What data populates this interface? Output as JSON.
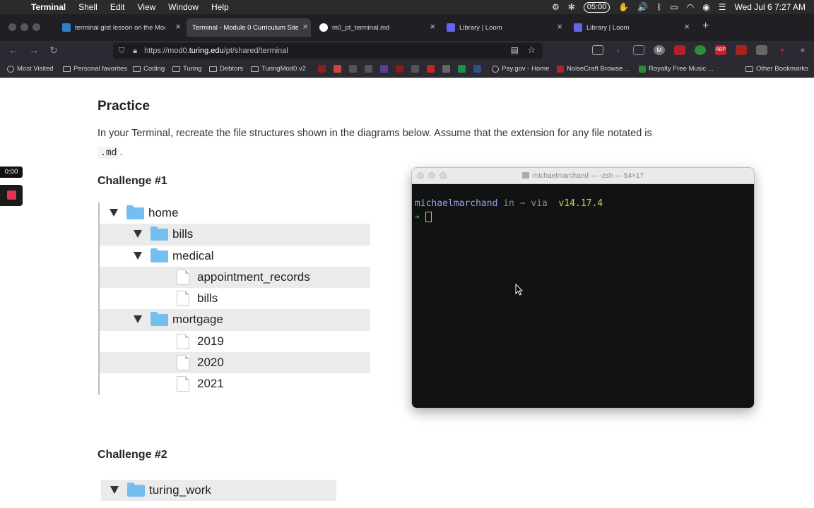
{
  "menubar": {
    "app_name": "Terminal",
    "menus": [
      "Shell",
      "Edit",
      "View",
      "Window",
      "Help"
    ],
    "timer": "05:00",
    "datetime": "Wed Jul 6  7:27 AM"
  },
  "tabs": [
    {
      "title": "terminal gist lesson on the Mod",
      "icon_color": "#2f80c9"
    },
    {
      "title": "Terminal - Module 0 Curriculum Site",
      "icon_color": "#3b3b41"
    },
    {
      "title": "m0_pt_terminal.md",
      "icon_color": "#ffffff"
    },
    {
      "title": "Library | Loom",
      "icon_color": "#6266e8"
    },
    {
      "title": "Library | Loom",
      "icon_color": "#6266e8"
    }
  ],
  "url": {
    "prefix": "https://mod0.",
    "domain": "turing.edu",
    "path": "/pt/shared/terminal"
  },
  "bookmarks": {
    "most_visited": "Most Visited",
    "personal_favorites": "Personal favorites",
    "coding": "Coding",
    "turing": "Turing",
    "debtors": "Debtors",
    "turingmod": "TuringMod0.v2",
    "paygov": "Pay.gov - Home",
    "noisecraft": "NoiseCraft Browse ...",
    "royalty": "Royalty Free Music ...",
    "other": "Other Bookmarks"
  },
  "page": {
    "heading": "Practice",
    "paragraph": "In your Terminal, recreate the file structures shown in the diagrams below. Assume that the extension for any file notated is",
    "extension": ".md",
    "period": ".",
    "challenge1": "Challenge #1",
    "challenge2": "Challenge #2"
  },
  "tree1": [
    {
      "name": "home",
      "type": "folder",
      "level": 0,
      "shaded": false
    },
    {
      "name": "bills",
      "type": "folder",
      "level": 1,
      "shaded": true
    },
    {
      "name": "medical",
      "type": "folder",
      "level": 1,
      "shaded": false
    },
    {
      "name": "appointment_records",
      "type": "file",
      "level": 2,
      "shaded": true
    },
    {
      "name": "bills",
      "type": "file",
      "level": 2,
      "shaded": false
    },
    {
      "name": "mortgage",
      "type": "folder",
      "level": 1,
      "shaded": true
    },
    {
      "name": "2019",
      "type": "file",
      "level": 2,
      "shaded": false
    },
    {
      "name": "2020",
      "type": "file",
      "level": 2,
      "shaded": true
    },
    {
      "name": "2021",
      "type": "file",
      "level": 2,
      "shaded": false
    }
  ],
  "tree2": [
    {
      "name": "turing_work",
      "type": "folder",
      "level": 0,
      "shaded": true
    }
  ],
  "loom": {
    "elapsed": "0:00"
  },
  "terminal": {
    "title": "michaelmarchand — -zsh — 54×17",
    "user": "michaelmarchand",
    "in": " in ",
    "dir": "~",
    "via": " via  ",
    "node": "v14.17.4",
    "arrow": "➜"
  }
}
